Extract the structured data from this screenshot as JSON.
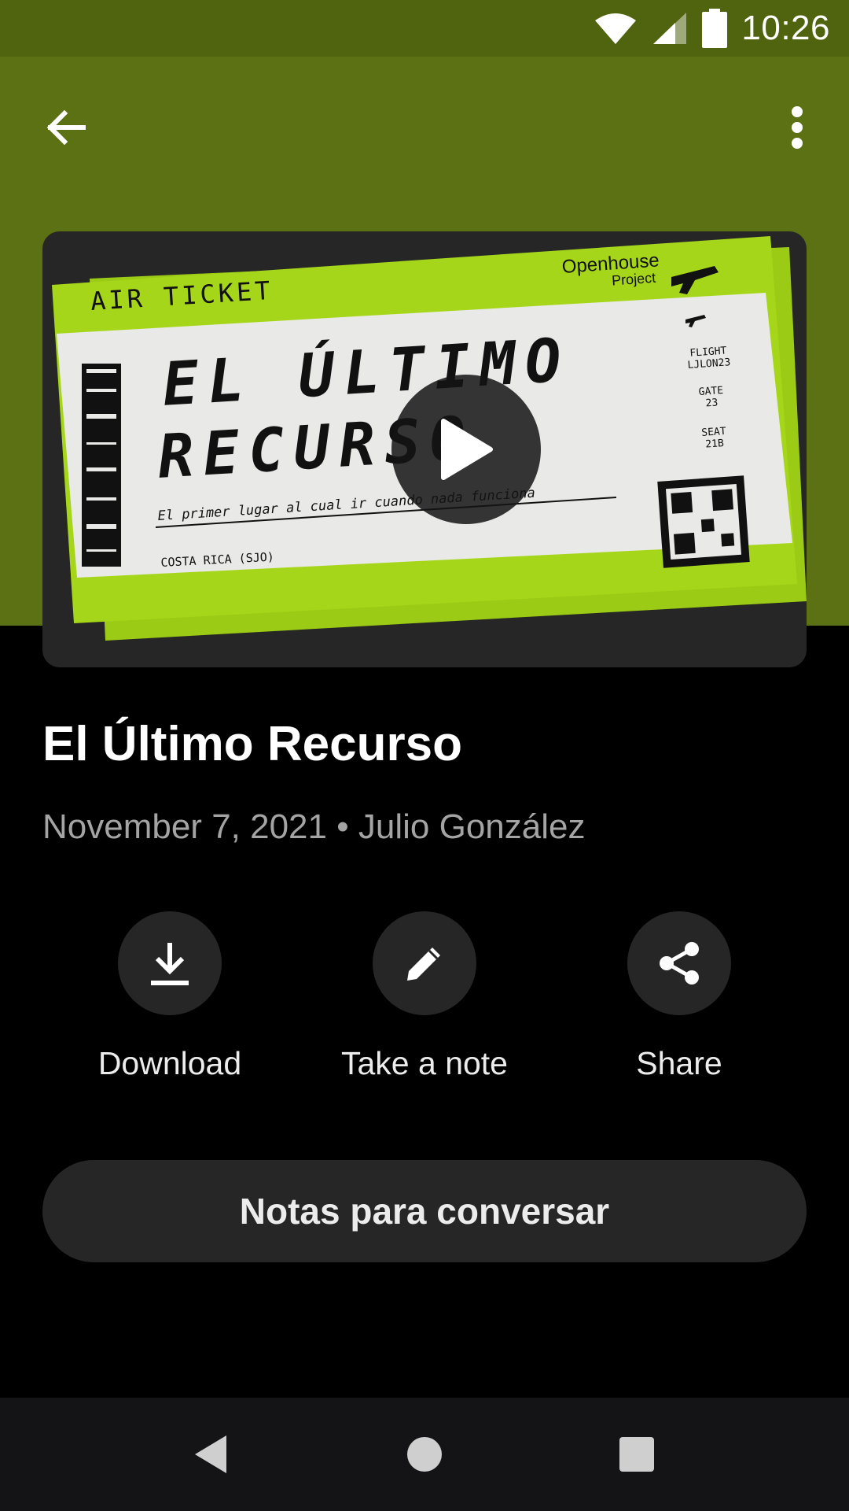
{
  "status_bar": {
    "time": "10:26"
  },
  "episode": {
    "title": "El Último Recurso",
    "date": "November 7, 2021",
    "separator": "•",
    "author": "Julio González"
  },
  "artwork": {
    "ticket_header": "AIR TICKET",
    "ticket_title_line1": "EL ÚLTIMO",
    "ticket_title_line2": "RECURSO",
    "ticket_tagline": "El primer lugar al cual ir cuando nada funciona",
    "ticket_origin": "COSTA RICA (SJO)",
    "brand_top": "Openhouse",
    "brand_bottom": "Project",
    "flight_label": "FLIGHT",
    "flight_value": "LJLON23",
    "gate_label": "GATE",
    "gate_value": "23",
    "seat_label": "SEAT",
    "seat_value": "21B"
  },
  "actions": {
    "download": "Download",
    "note": "Take a note",
    "share": "Share"
  },
  "notes_button": "Notas para conversar",
  "colors": {
    "header_green": "#5c7113",
    "status_green": "#50640f",
    "ticket_lime": "#a3d318",
    "surface": "#262626"
  },
  "icons": {
    "back": "arrow-left-icon",
    "menu": "more-vert-icon",
    "play": "play-icon",
    "download": "download-icon",
    "note": "pencil-icon",
    "share": "share-icon"
  }
}
